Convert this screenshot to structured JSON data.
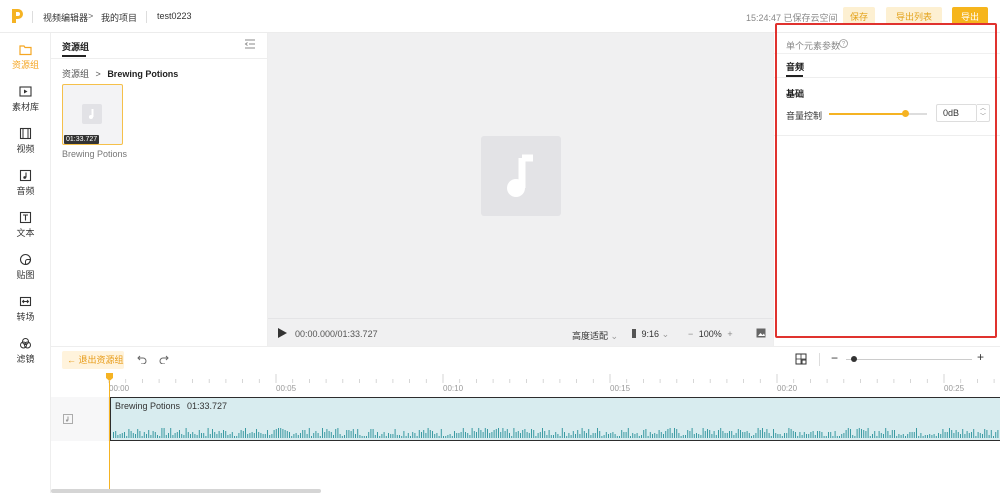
{
  "topbar": {
    "app_name": "视频编辑器",
    "breadcrumb_sep": ">",
    "project_link": "我的项目",
    "project_name": "test0223",
    "save_status": "15:24:47 已保存云空间",
    "save_label": "保存",
    "export_list_label": "导出列表",
    "export_label": "导出"
  },
  "nav": {
    "items": [
      {
        "label": "资源组",
        "icon": "folder-icon",
        "active": true
      },
      {
        "label": "素材库",
        "icon": "media-library-icon"
      },
      {
        "label": "视频",
        "icon": "film-icon"
      },
      {
        "label": "音频",
        "icon": "music-note-icon"
      },
      {
        "label": "文本",
        "icon": "text-icon"
      },
      {
        "label": "贴图",
        "icon": "sticker-icon"
      },
      {
        "label": "转场",
        "icon": "transition-icon"
      },
      {
        "label": "滤镜",
        "icon": "filter-icon"
      }
    ]
  },
  "resources": {
    "tab_label": "资源组",
    "crumb_root": "资源组",
    "crumb_sep": ">",
    "crumb_current": "Brewing Potions",
    "item_duration": "01:33.727",
    "item_name": "Brewing Potions"
  },
  "player": {
    "time": "00:00.000/01:33.727",
    "fit_label": "高度适配",
    "ratio_label": "9:16",
    "zoom_minus": "−",
    "zoom_label": "100%",
    "zoom_plus": "+"
  },
  "properties": {
    "title": "单个元素参数",
    "tab_label": "音频",
    "section_label": "基础",
    "volume_label": "音量控制",
    "volume_value": "0dB",
    "volume_slider_fraction": 0.78
  },
  "timeline": {
    "exit_group_label": "← 退出资源组",
    "zoom_minus": "−",
    "zoom_plus": "+",
    "ruler_labels": [
      "00:00",
      "00:05",
      "00:10",
      "00:15",
      "00:20",
      "00:25"
    ],
    "clip_name": "Brewing Potions",
    "clip_duration": "01:33.727"
  },
  "colors": {
    "accent": "#f5b323",
    "highlight_border": "#e0322e",
    "clip_bg": "#d8ecef",
    "waveform": "#3a9aa2"
  }
}
